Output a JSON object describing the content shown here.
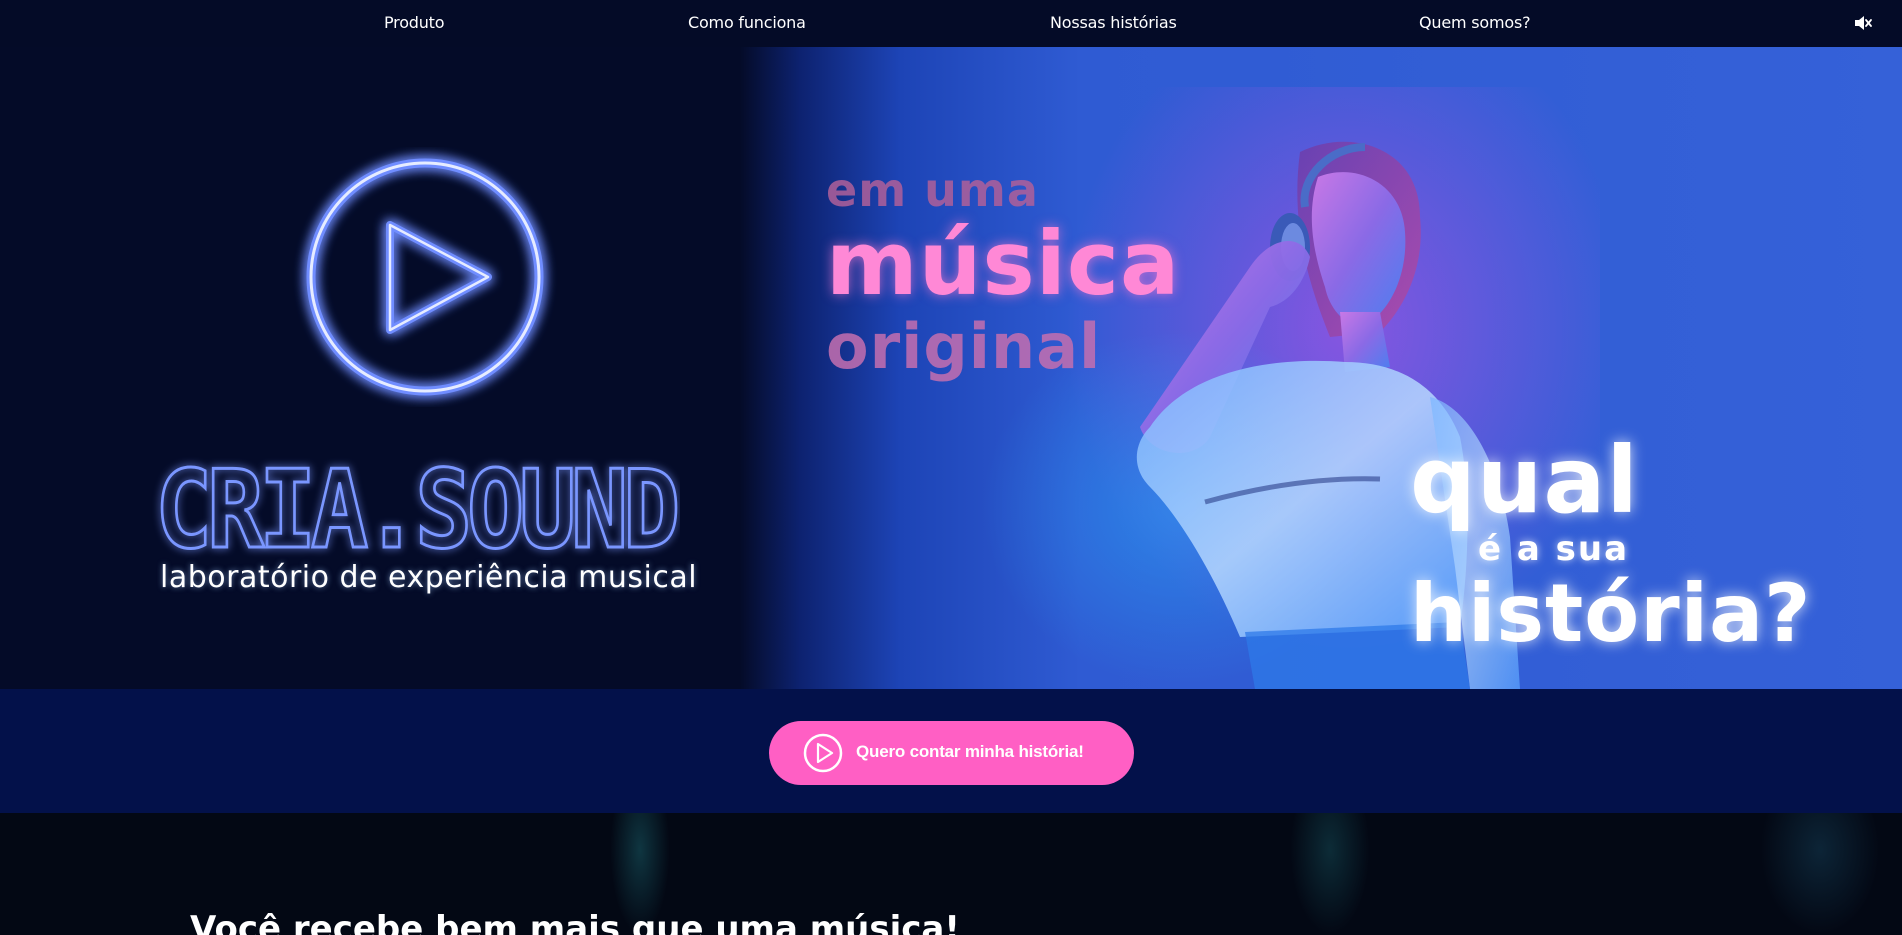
{
  "nav": {
    "items": [
      {
        "label": "Produto"
      },
      {
        "label": "Como funciona"
      },
      {
        "label": "Nossas histórias"
      },
      {
        "label": "Quem somos?"
      }
    ],
    "mute_icon": "speaker-mute-icon"
  },
  "hero": {
    "brand": "CRIA.SOUND",
    "tagline": "laboratório de experiência musical",
    "headline_1": "em uma",
    "headline_2": "música",
    "headline_3": "original",
    "question_1": "qual",
    "question_2": "é a sua",
    "question_3": "história?",
    "colors": {
      "neon_blue": "#5a7dff",
      "neon_pink": "#ff88d6",
      "background": "#040b27",
      "photo_blue": "#3561d8"
    }
  },
  "cta": {
    "label": "Quero contar minha história!",
    "icon": "play-circle-icon",
    "color": "#ff5fc4"
  },
  "section": {
    "heading": "Você recebe bem mais que uma música!"
  }
}
